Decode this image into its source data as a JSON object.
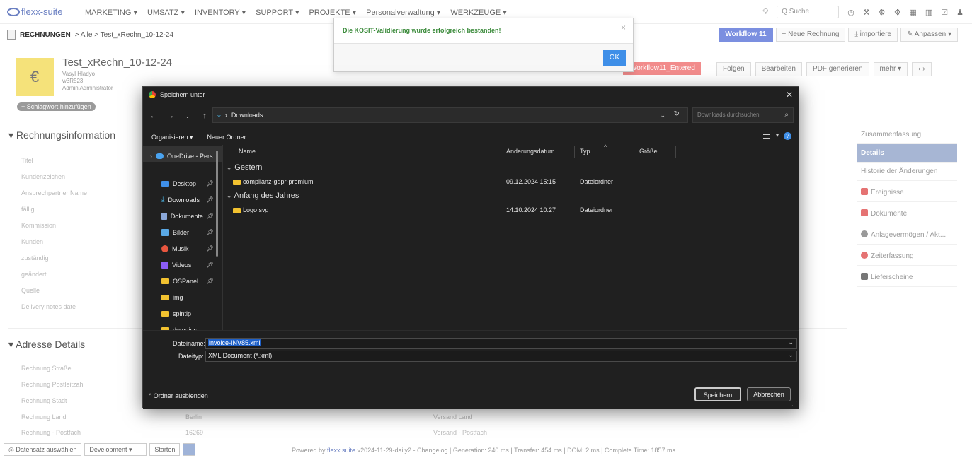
{
  "app": {
    "logo_text": "flexx-suite",
    "menu": [
      "MARKETING ▾",
      "UMSATZ ▾",
      "INVENTORY ▾",
      "SUPPORT ▾",
      "PROJEKTE ▾",
      "Personalverwaltung ▾",
      "WERKZEUGE ▾"
    ],
    "search_placeholder": "Q  Suche"
  },
  "breadcrumb": {
    "module": "RECHNUNGEN",
    "path": "> Alle > Test_xRechn_10-12-24"
  },
  "toolbar": {
    "workflow": "Workflow 11",
    "new_invoice": "+ Neue Rechnung",
    "import": "⤓ importiere",
    "customize": "✎ Anpassen ▾"
  },
  "record": {
    "title": "Test_xRechn_10-12-24",
    "sub1": "Vasyl Hladyo",
    "sub2": "w3R523",
    "sub3": "Admin Administrator",
    "tag_button": "+ Schlagwort hinzufügen",
    "status": "Workflow11_Entered",
    "actions": [
      "Folgen",
      "Bearbeiten",
      "PDF generieren",
      "mehr ▾",
      "‹  ›"
    ]
  },
  "section_invoice": {
    "title": "▾ Rechnungsinformation",
    "fields": [
      "Titel",
      "Kundenzeichen",
      "Ansprechpartner Name",
      "fällig",
      "Kommission",
      "Kunden",
      "zuständig",
      "geändert",
      "Quelle",
      "Delivery notes date"
    ]
  },
  "section_address": {
    "title": "▾ Adresse Details",
    "fields": [
      "Rechnung Straße",
      "Rechnung Postleitzahl",
      "Rechnung Stadt",
      "Rechnung Land",
      "Rechnung - Postfach"
    ],
    "land_value": "Berlin",
    "postfach_value": "16269",
    "versand_land": "Versand Land",
    "versand_postfach": "Versand - Postfach"
  },
  "right_panel": {
    "items": [
      "Zusammenfassung",
      "Details",
      "Historie der Änderungen",
      "Ereignisse",
      "Dokumente",
      "Anlagevermögen / Akt...",
      "Zeiterfassung",
      "Lieferscheine"
    ]
  },
  "footer": {
    "select_record": "Datensatz auswählen",
    "env": "Development",
    "start": "Starten",
    "powered_prefix": "Powered by",
    "powered_brand": "flexx.suite",
    "powered_rest": "v2024-11-29-daily2 - Changelog | Generation: 240 ms | Transfer: 454 ms | DOM: 2 ms | Complete Time: 1857 ms"
  },
  "alert": {
    "message": "Die KOSIT-Validierung wurde erfolgreich bestanden!",
    "ok": "OK"
  },
  "save_dialog": {
    "title": "Speichern unter",
    "address": "Downloads",
    "search_placeholder": "Downloads durchsuchen",
    "organize": "Organisieren ▾",
    "new_folder": "Neuer Ordner",
    "columns": [
      "Name",
      "Änderungsdatum",
      "Typ",
      "Größe"
    ],
    "nav_items": [
      {
        "label": "OneDrive - Pers",
        "color": "#4aa3f0"
      },
      {
        "label": "Desktop",
        "color": "#3f8fe8"
      },
      {
        "label": "Downloads",
        "color": "#4fc3f7"
      },
      {
        "label": "Dokumente",
        "color": "#8aa7d8"
      },
      {
        "label": "Bilder",
        "color": "#5aa9e6"
      },
      {
        "label": "Musik",
        "color": "#e8563f"
      },
      {
        "label": "Videos",
        "color": "#8b5cf6"
      },
      {
        "label": "OSPanel",
        "color": "#f2c230"
      },
      {
        "label": "img",
        "color": "#f2c230"
      },
      {
        "label": "spintip",
        "color": "#f2c230"
      },
      {
        "label": "domains",
        "color": "#f2c230"
      }
    ],
    "groups": [
      {
        "label": "Gestern",
        "files": [
          {
            "name": "complianz-gdpr-premium",
            "date": "09.12.2024 15:15",
            "type": "Dateiordner"
          }
        ]
      },
      {
        "label": "Anfang des Jahres",
        "files": [
          {
            "name": "Logo svg",
            "date": "14.10.2024 10:27",
            "type": "Dateiordner"
          }
        ]
      }
    ],
    "filename_label": "Dateiname:",
    "filename": "invoice-INV85.xml",
    "filetype_label": "Dateityp:",
    "filetype": "XML Document (*.xml)",
    "hide_folders": "^  Ordner ausblenden",
    "save": "Speichern",
    "cancel": "Abbrechen"
  }
}
